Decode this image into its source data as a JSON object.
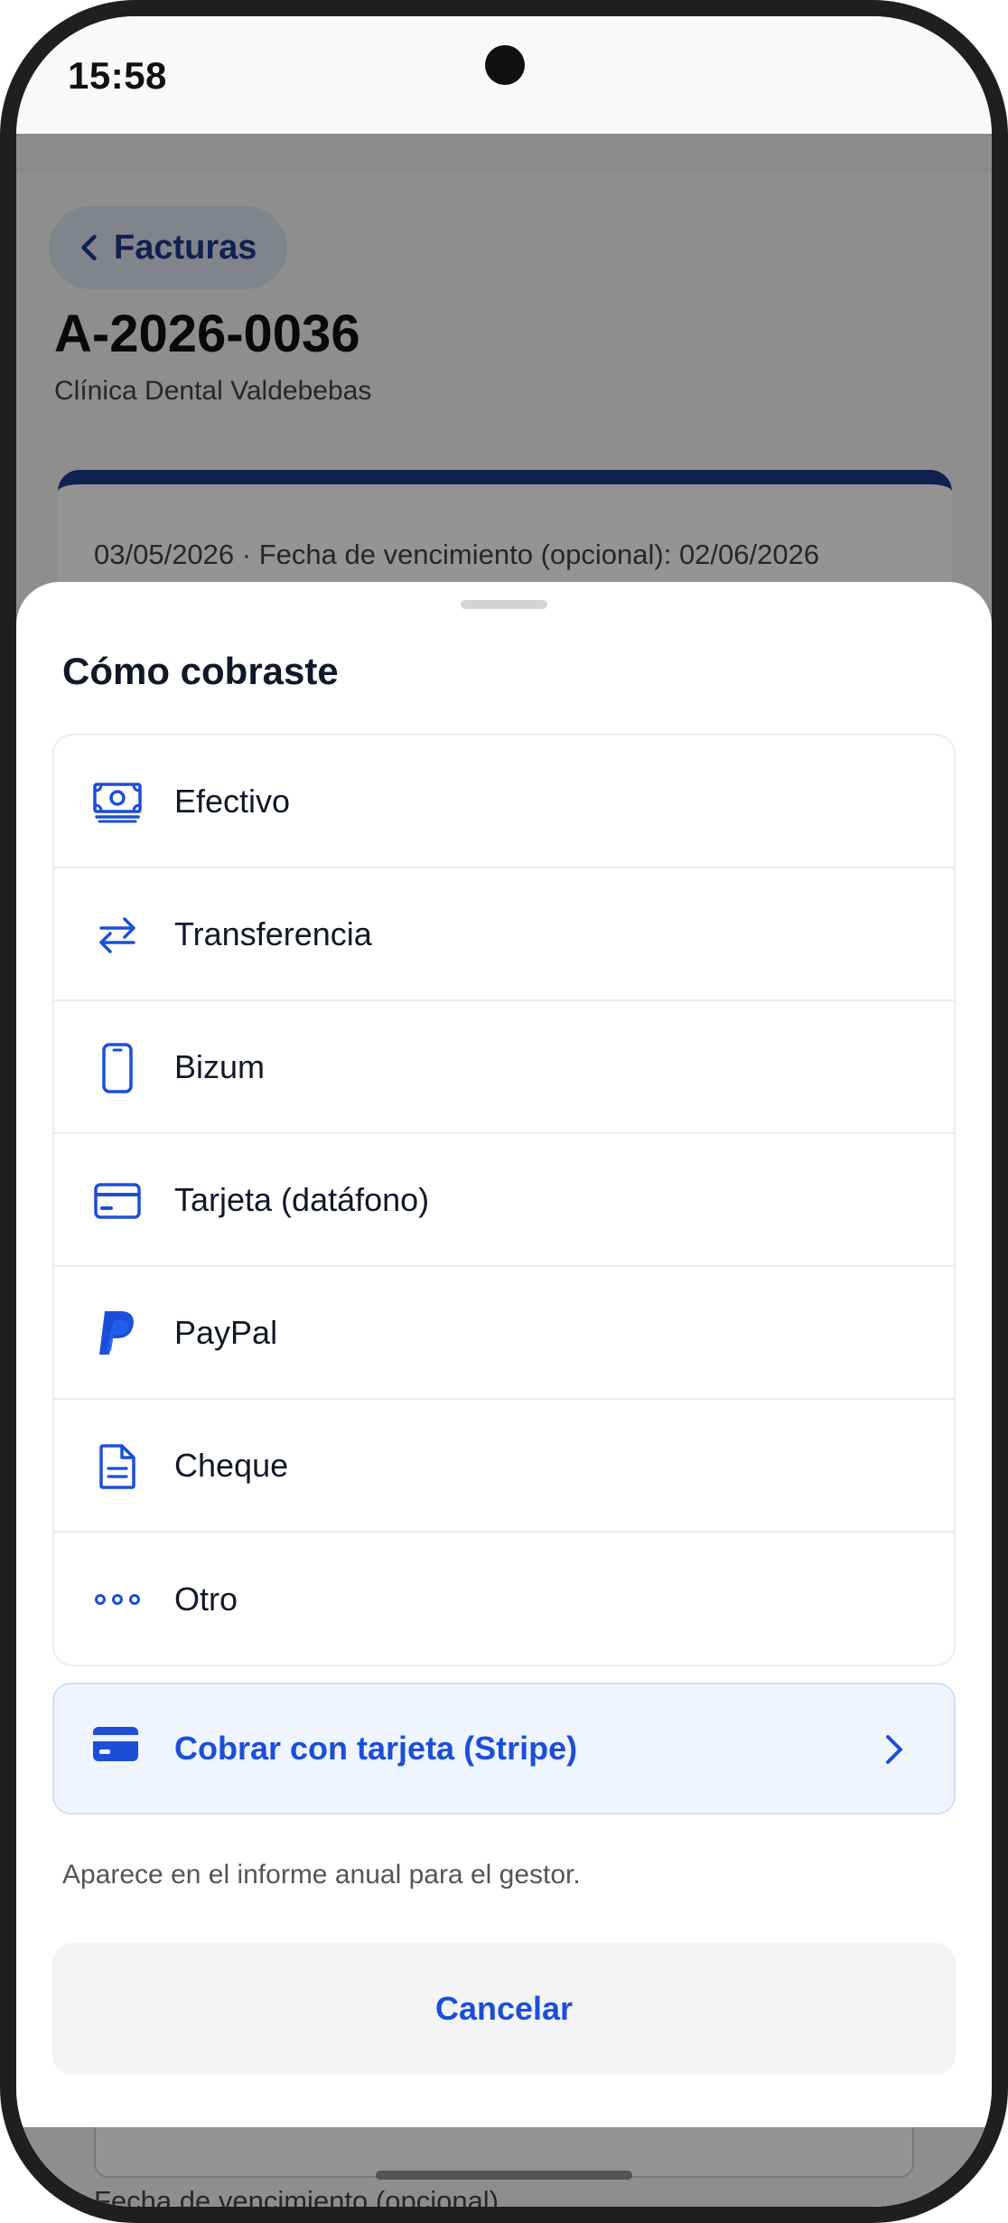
{
  "status_bar": {
    "time": "15:58"
  },
  "background_page": {
    "back_label": "Facturas",
    "invoice_number": "A-2026-0036",
    "client_name": "Clínica Dental Valdebebas",
    "card_line": "03/05/2026 · Fecha de vencimiento (opcional): 02/06/2026",
    "field_label": "Fecha de vencimiento (opcional)"
  },
  "sheet": {
    "title": "Cómo cobraste",
    "methods": [
      {
        "label": "Efectivo",
        "icon": "cash-icon"
      },
      {
        "label": "Transferencia",
        "icon": "transfer-arrows-icon"
      },
      {
        "label": "Bizum",
        "icon": "phone-icon"
      },
      {
        "label": "Tarjeta (datáfono)",
        "icon": "card-icon"
      },
      {
        "label": "PayPal",
        "icon": "paypal-icon"
      },
      {
        "label": "Cheque",
        "icon": "document-icon"
      },
      {
        "label": "Otro",
        "icon": "more-dots-icon"
      }
    ],
    "stripe_label": "Cobrar con tarjeta (Stripe)",
    "note": "Aparece en el informe anual para el gestor.",
    "cancel_label": "Cancelar"
  },
  "colors": {
    "accent": "#1d4ed8",
    "navy": "#1e3a8a",
    "stripe_bg": "#eef5ff"
  }
}
